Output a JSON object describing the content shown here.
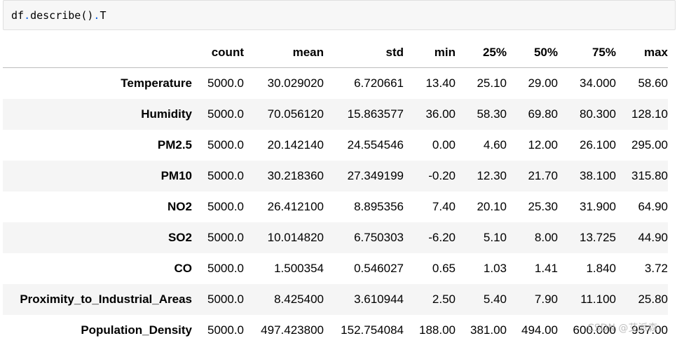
{
  "code_cell": {
    "tokens": [
      "df",
      ".",
      "describe",
      "()",
      ".",
      "T"
    ]
  },
  "table": {
    "index_header": "",
    "columns": [
      "count",
      "mean",
      "std",
      "min",
      "25%",
      "50%",
      "75%",
      "max"
    ],
    "rows": [
      {
        "label": "Temperature",
        "values": [
          "5000.0",
          "30.029020",
          "6.720661",
          "13.40",
          "25.10",
          "29.00",
          "34.000",
          "58.60"
        ]
      },
      {
        "label": "Humidity",
        "values": [
          "5000.0",
          "70.056120",
          "15.863577",
          "36.00",
          "58.30",
          "69.80",
          "80.300",
          "128.10"
        ]
      },
      {
        "label": "PM2.5",
        "values": [
          "5000.0",
          "20.142140",
          "24.554546",
          "0.00",
          "4.60",
          "12.00",
          "26.100",
          "295.00"
        ]
      },
      {
        "label": "PM10",
        "values": [
          "5000.0",
          "30.218360",
          "27.349199",
          "-0.20",
          "12.30",
          "21.70",
          "38.100",
          "315.80"
        ]
      },
      {
        "label": "NO2",
        "values": [
          "5000.0",
          "26.412100",
          "8.895356",
          "7.40",
          "20.10",
          "25.30",
          "31.900",
          "64.90"
        ]
      },
      {
        "label": "SO2",
        "values": [
          "5000.0",
          "10.014820",
          "6.750303",
          "-6.20",
          "5.10",
          "8.00",
          "13.725",
          "44.90"
        ]
      },
      {
        "label": "CO",
        "values": [
          "5000.0",
          "1.500354",
          "0.546027",
          "0.65",
          "1.03",
          "1.41",
          "1.840",
          "3.72"
        ]
      },
      {
        "label": "Proximity_to_Industrial_Areas",
        "values": [
          "5000.0",
          "8.425400",
          "3.610944",
          "2.50",
          "5.40",
          "7.90",
          "11.100",
          "25.80"
        ]
      },
      {
        "label": "Population_Density",
        "values": [
          "5000.0",
          "497.423800",
          "152.754084",
          "188.00",
          "381.00",
          "494.00",
          "600.000",
          "957.00"
        ]
      }
    ]
  },
  "watermark": "CSDN @艾派森",
  "colors": {
    "code_background": "#f7f7f7",
    "code_operator": "#055be0",
    "row_stripe": "#f5f5f5",
    "header_rule": "#bdbdbd"
  }
}
